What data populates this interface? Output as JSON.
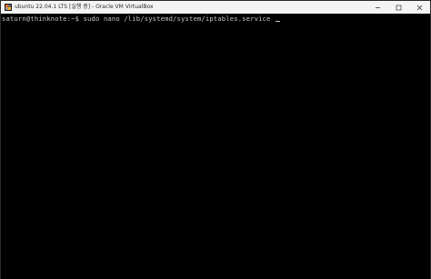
{
  "window": {
    "title": "ubuntu 22.04.1 LTS [실행 중] - Oracle VM VirtualBox",
    "app_icon": "virtualbox-icon",
    "controls": [
      {
        "name": "minimize-button",
        "icon": "minimize-icon"
      },
      {
        "name": "maximize-button",
        "icon": "maximize-icon"
      },
      {
        "name": "close-button",
        "icon": "close-icon"
      }
    ]
  },
  "terminal": {
    "prompt": "saturn@thinknote:~$",
    "command": "sudo nano /lib/systemd/system/iptables.service"
  },
  "colors": {
    "titlebar_bg": "#f4f4f4",
    "terminal_bg": "#000000",
    "terminal_fg": "#c8c8c8"
  }
}
